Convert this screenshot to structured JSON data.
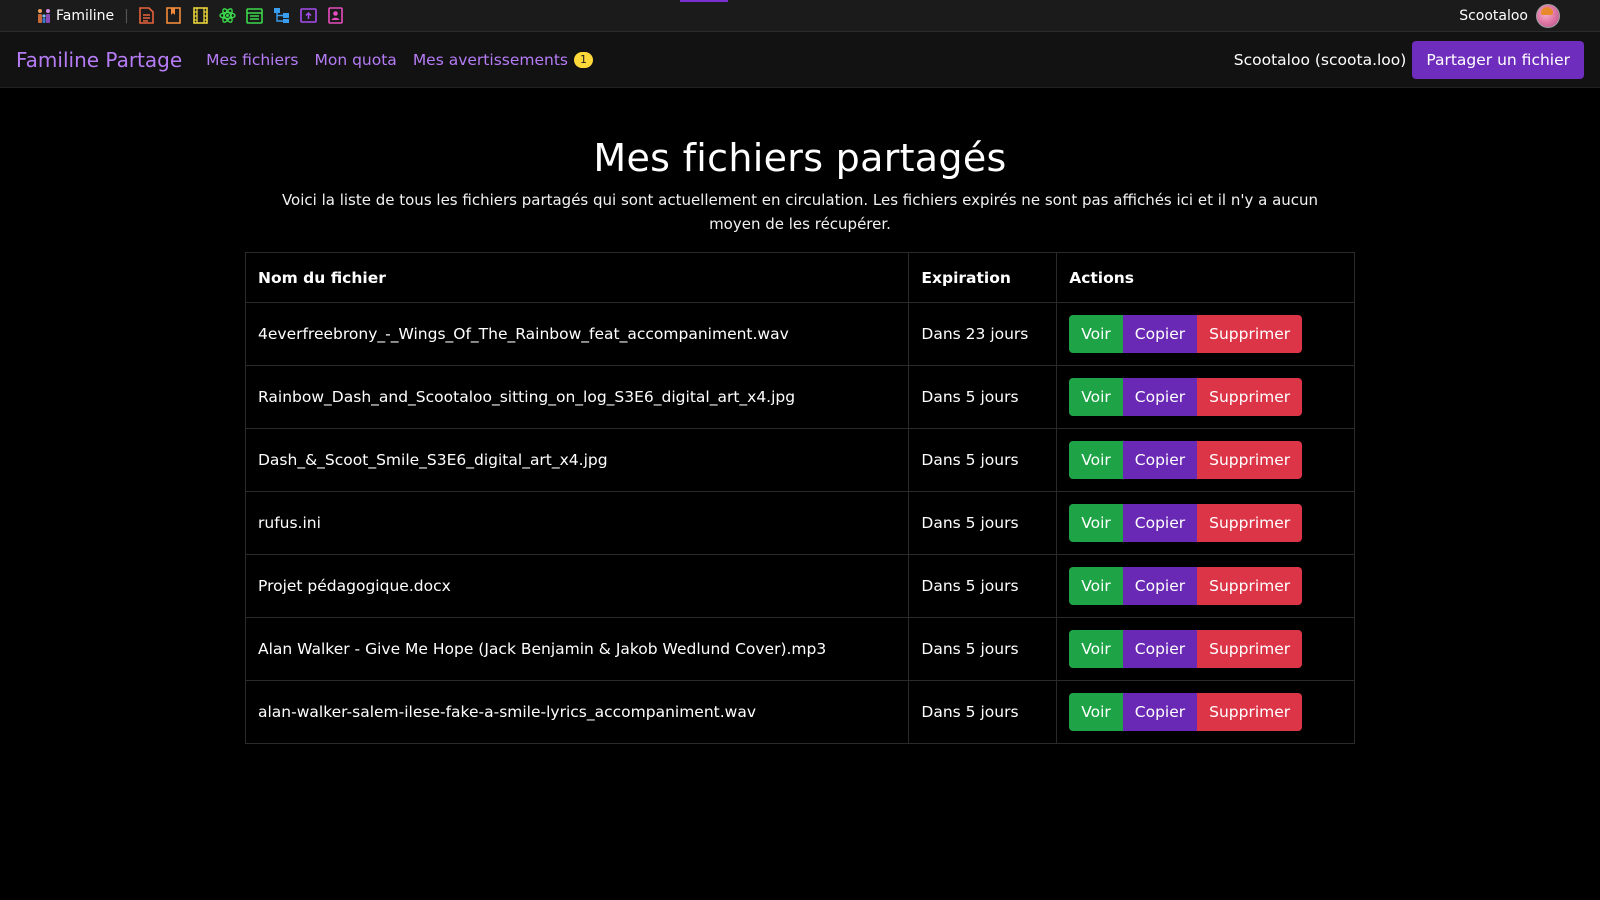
{
  "system_bar": {
    "app_name": "Familine",
    "separator": "|",
    "icons": [
      {
        "name": "document-icon",
        "color": "#e8623c"
      },
      {
        "name": "bookmark-icon",
        "color": "#f08a3a"
      },
      {
        "name": "film-icon",
        "color": "#e8d33a"
      },
      {
        "name": "atom-icon",
        "color": "#3ad84a"
      },
      {
        "name": "calendar-icon",
        "color": "#3ad84a"
      },
      {
        "name": "network-icon",
        "color": "#3a9ef0"
      },
      {
        "name": "upload-box-icon",
        "color": "#a64cf0"
      },
      {
        "name": "contact-icon",
        "color": "#e84cc0"
      }
    ],
    "user_name": "Scootaloo"
  },
  "navbar": {
    "brand": "Familine Partage",
    "links": [
      "Mes fichiers",
      "Mon quota",
      "Mes avertissements"
    ],
    "warnings_count": "1",
    "user_display": "Scootaloo (scoota.loo)",
    "share_button": "Partager un fichier"
  },
  "main": {
    "title": "Mes fichiers partagés",
    "description": "Voici la liste de tous les fichiers partagés qui sont actuellement en circulation. Les fichiers expirés ne sont pas affichés ici et il n'y a aucun moyen de les récupérer.",
    "table": {
      "headers": [
        "Nom du fichier",
        "Expiration",
        "Actions"
      ],
      "rows": [
        {
          "name": "4everfreebrony_-_Wings_Of_The_Rainbow_feat_accompaniment.wav",
          "expiration": "Dans 23 jours"
        },
        {
          "name": "Rainbow_Dash_and_Scootaloo_sitting_on_log_S3E6_digital_art_x4.jpg",
          "expiration": "Dans 5 jours"
        },
        {
          "name": "Dash_&_Scoot_Smile_S3E6_digital_art_x4.jpg",
          "expiration": "Dans 5 jours"
        },
        {
          "name": "rufus.ini",
          "expiration": "Dans 5 jours"
        },
        {
          "name": "Projet pédagogique.docx",
          "expiration": "Dans 5 jours"
        },
        {
          "name": "Alan Walker - Give Me Hope (Jack Benjamin & Jakob Wedlund Cover).mp3",
          "expiration": "Dans 5 jours"
        },
        {
          "name": "alan-walker-salem-ilese-fake-a-smile-lyrics_accompaniment.wav",
          "expiration": "Dans 5 jours"
        }
      ],
      "actions": {
        "view": "Voir",
        "copy": "Copier",
        "delete": "Supprimer"
      }
    }
  },
  "colors": {
    "accent": "#b57cf5",
    "primary_button": "#6f2dbd",
    "view": "#1ea446",
    "copy": "#6929b4",
    "delete": "#dd3548",
    "badge": "#ffd83a"
  }
}
